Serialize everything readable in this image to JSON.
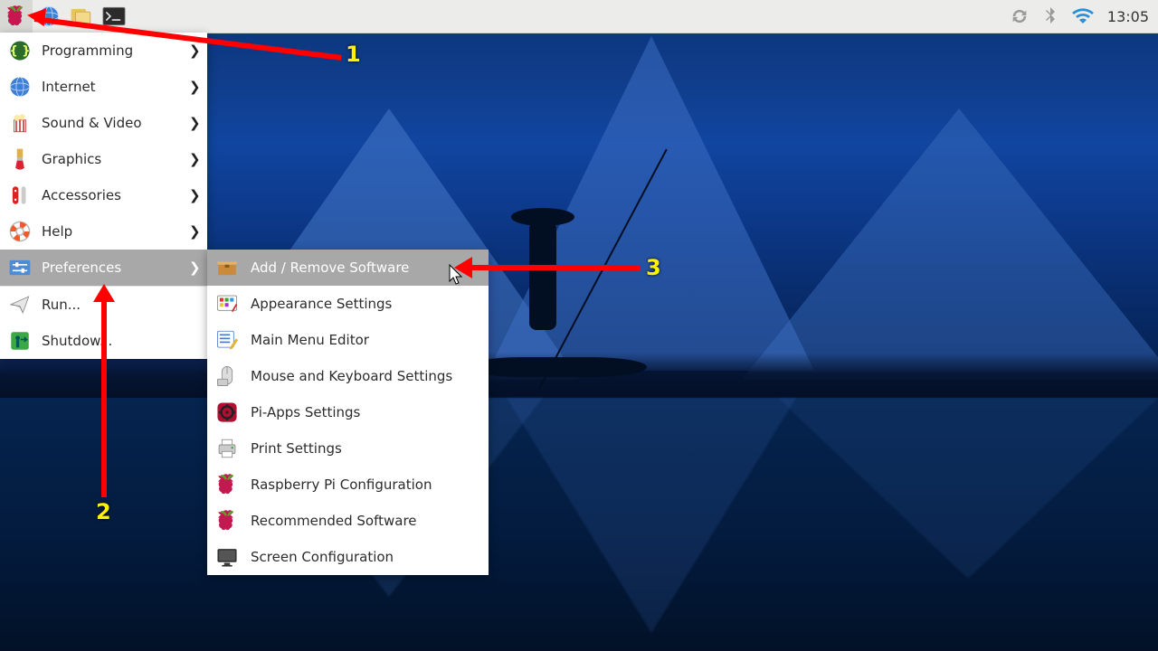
{
  "taskbar": {
    "clock": "13:05"
  },
  "menu": {
    "items": [
      {
        "label": "Programming",
        "has_sub": true,
        "icon": "code"
      },
      {
        "label": "Internet",
        "has_sub": true,
        "icon": "globe"
      },
      {
        "label": "Sound & Video",
        "has_sub": true,
        "icon": "popcorn"
      },
      {
        "label": "Graphics",
        "has_sub": true,
        "icon": "brush"
      },
      {
        "label": "Accessories",
        "has_sub": true,
        "icon": "knife"
      },
      {
        "label": "Help",
        "has_sub": true,
        "icon": "lifebuoy"
      },
      {
        "label": "Preferences",
        "has_sub": true,
        "icon": "sliders",
        "selected": true
      },
      {
        "label": "Run...",
        "has_sub": false,
        "icon": "paperplane"
      },
      {
        "label": "Shutdow...",
        "has_sub": false,
        "icon": "exit"
      }
    ]
  },
  "submenu": {
    "items": [
      {
        "label": "Add / Remove Software",
        "icon": "box",
        "selected": true
      },
      {
        "label": "Appearance Settings",
        "icon": "palette"
      },
      {
        "label": "Main Menu Editor",
        "icon": "menuedit"
      },
      {
        "label": "Mouse and Keyboard Settings",
        "icon": "mouse"
      },
      {
        "label": "Pi-Apps Settings",
        "icon": "piapps"
      },
      {
        "label": "Print Settings",
        "icon": "printer"
      },
      {
        "label": "Raspberry Pi Configuration",
        "icon": "raspberry"
      },
      {
        "label": "Recommended Software",
        "icon": "raspberry"
      },
      {
        "label": "Screen Configuration",
        "icon": "monitor"
      }
    ]
  },
  "annotations": {
    "n1": "1",
    "n2": "2",
    "n3": "3"
  }
}
